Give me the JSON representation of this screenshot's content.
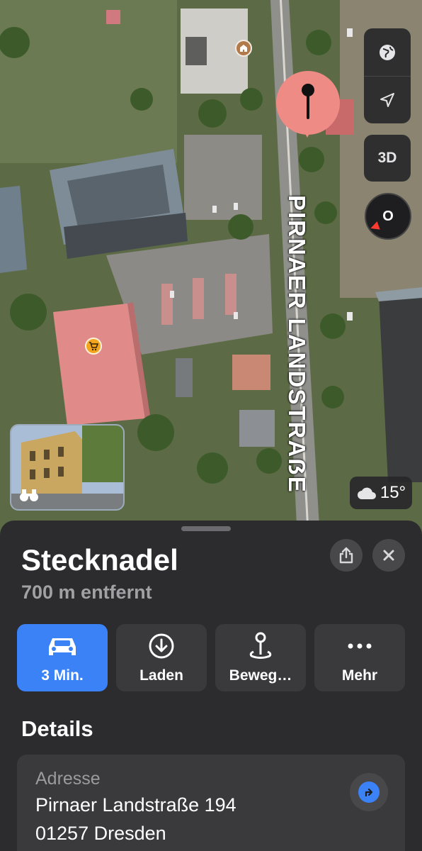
{
  "map": {
    "street_name": "PIRNAER LANDSTRAẞE",
    "icons": {
      "school_poi": "school-icon",
      "shop_poi": "shopping-cart-icon",
      "pin": "pin-icon",
      "globe": "globe-icon",
      "location": "location-arrow-icon",
      "binoculars": "binoculars-icon",
      "weather": "cloud-icon"
    },
    "view_3d_label": "3D",
    "compass_label": "O",
    "weather_temp": "15°"
  },
  "sheet": {
    "title": "Stecknadel",
    "subtitle": "700 m entfernt",
    "actions": [
      {
        "label": "3 Min.",
        "icon": "car-icon"
      },
      {
        "label": "Laden",
        "icon": "download-icon"
      },
      {
        "label": "Beweg…",
        "icon": "move-pin-icon"
      },
      {
        "label": "Mehr",
        "icon": "more-icon"
      }
    ],
    "details_heading": "Details",
    "address": {
      "label": "Adresse",
      "line1": "Pirnaer Landstraße 194",
      "line2": "01257 Dresden"
    }
  },
  "colors": {
    "accent": "#3a82f6",
    "pin": "#ee8b85",
    "sheet_bg": "#2c2c2e",
    "card_bg": "#3a3a3c"
  }
}
